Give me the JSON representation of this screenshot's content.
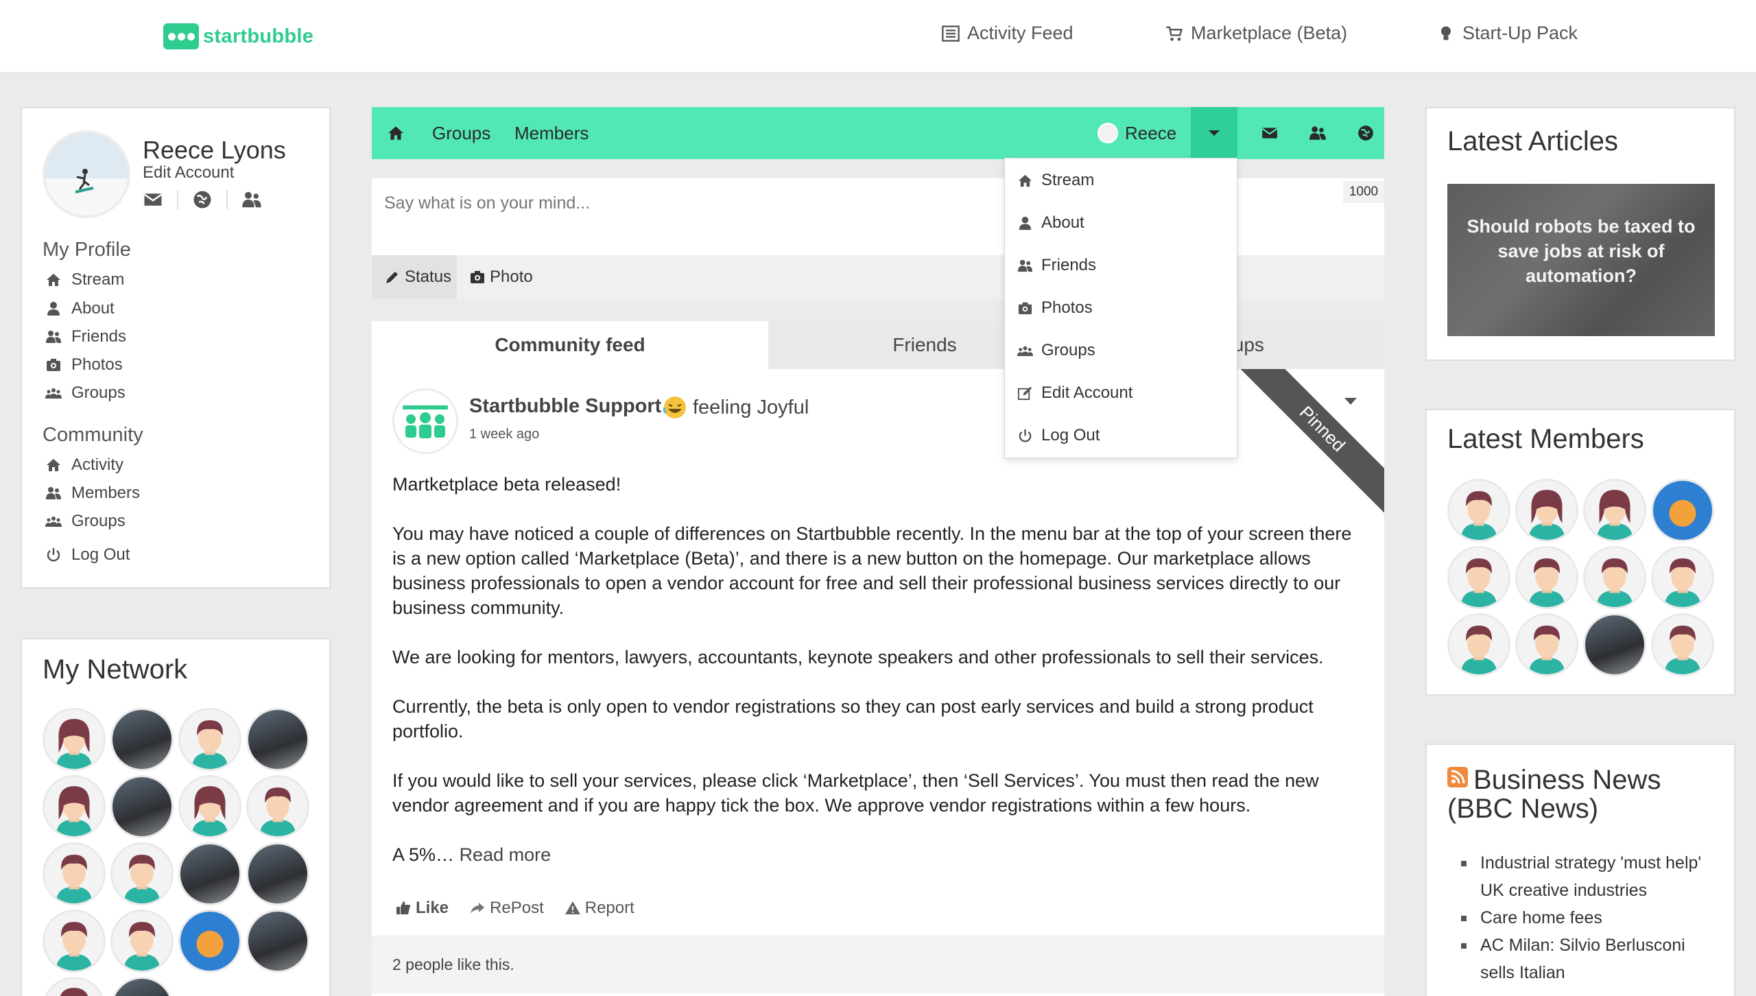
{
  "brand": {
    "name": "startbubble",
    "color": "#2ecc8e"
  },
  "topnav": [
    {
      "label": "Activity Feed",
      "icon": "list-icon"
    },
    {
      "label": "Marketplace (Beta)",
      "icon": "cart-icon"
    },
    {
      "label": "Start-Up Pack",
      "icon": "lightbulb-icon"
    }
  ],
  "profile": {
    "name": "Reece Lyons",
    "edit_label": "Edit Account",
    "my_profile_heading": "My Profile",
    "my_profile_items": [
      "Stream",
      "About",
      "Friends",
      "Photos",
      "Groups"
    ],
    "community_heading": "Community",
    "community_items": [
      "Activity",
      "Members",
      "Groups"
    ],
    "logout": "Log Out"
  },
  "network": {
    "title": "My Network"
  },
  "groupbar": {
    "groups": "Groups",
    "members": "Members",
    "user": "Reece",
    "accent": "#52e8b3"
  },
  "composer": {
    "placeholder": "Say what is on your mind...",
    "char_count": "1000",
    "tab_status": "Status",
    "tab_photo": "Photo"
  },
  "feed_tabs": [
    "Community feed",
    "Friends",
    "Groups"
  ],
  "dropdown": [
    "Stream",
    "About",
    "Friends",
    "Photos",
    "Groups",
    "Edit Account",
    "Log Out"
  ],
  "post": {
    "author": "Startbubble Support",
    "feeling": "feeling Joyful",
    "time": "1 week ago",
    "ribbon": "Pinned",
    "title": "Martketplace beta released!",
    "paragraphs": [
      "You may have noticed a couple of differences on Startbubble recently. In the menu bar at the top of your screen there is a new option called ‘Marketplace (Beta)’, and there is a new button on the homepage. Our marketplace allows business professionals to open a vendor account for free and sell their professional business services directly to our business community.",
      "We are looking for mentors, lawyers, accountants, keynote speakers and other professionals to sell their services.",
      "Currently, the beta is only open to vendor registrations so they can post early services and build a strong product portfolio.",
      "If you would like to sell your services, please click ‘Marketplace’, then ‘Sell Services’. You must then read the new vendor agreement and if you are happy tick the box. We approve vendor registrations within a few hours."
    ],
    "excerpt_end": "A 5%…",
    "read_more": "Read more",
    "like": "Like",
    "repost": "RePost",
    "report": "Report",
    "likes_text": "2 people like this."
  },
  "articles": {
    "title": "Latest Articles",
    "slide_text": "Should robots be taxed to save jobs at risk of automation?"
  },
  "members": {
    "title": "Latest Members"
  },
  "news": {
    "title": "Business News (BBC News)",
    "items": [
      "Industrial strategy 'must help' UK creative industries",
      "Care home fees",
      "AC Milan: Silvio Berlusconi sells Italian"
    ]
  }
}
